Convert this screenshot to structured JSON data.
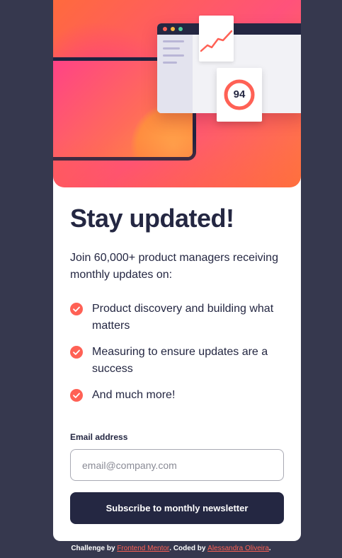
{
  "hero": {
    "score": "94",
    "colors": {
      "accent": "#ff6155",
      "dark_navy": "#242742",
      "page_background": "#36384e",
      "window_dot_red": "#ff6155",
      "window_dot_yellow": "#f5b742",
      "window_dot_green": "#4fcf9a"
    }
  },
  "content": {
    "title": "Stay updated!",
    "intro": "Join 60,000+ product managers receiving monthly updates on:",
    "benefits": [
      {
        "text": "Product discovery and building what matters",
        "icon": "check-icon"
      },
      {
        "text": "Measuring to ensure updates are a success",
        "icon": "check-icon"
      },
      {
        "text": "And much more!",
        "icon": "check-icon"
      }
    ]
  },
  "form": {
    "email_label": "Email address",
    "email_placeholder": "email@company.com",
    "email_value": "",
    "submit_label": "Subscribe to monthly newsletter"
  },
  "attribution": {
    "challenge_prefix": "Challenge by ",
    "challenge_link": "Frontend Mentor",
    "coded_prefix": ". Coded by ",
    "coded_link": "Alessandra Oliveira",
    "suffix": "."
  }
}
